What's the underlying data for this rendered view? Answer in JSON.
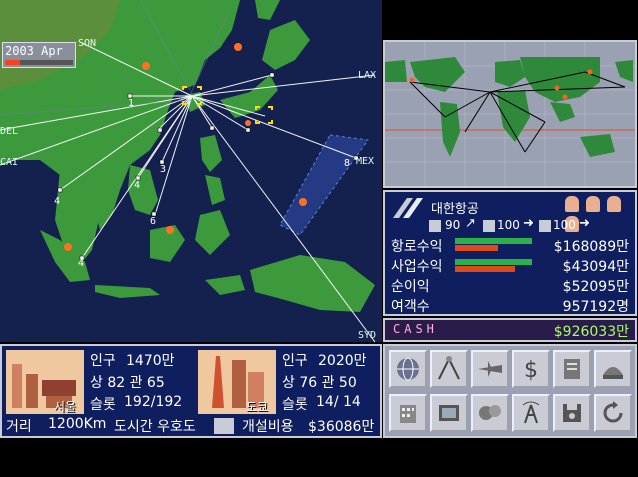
{
  "date": "2003 Apr",
  "map_labels": {
    "seoul_short": "SON",
    "lax": "LAX",
    "mex": "MEX",
    "syd": "SYD",
    "del": "DEL",
    "cai": "CAI",
    "n1": "1",
    "n2": "2",
    "n3": "3",
    "n4a": "4",
    "n4b": "4",
    "n4c": "4",
    "n5": "5",
    "n6": "6",
    "n8": "8"
  },
  "airline": {
    "name": "대한항공",
    "planes_a": "90",
    "planes_b": "100",
    "planes_c": "100",
    "rows": [
      {
        "label": "항로수익",
        "value": "$168089만"
      },
      {
        "label": "사업수익",
        "value": "$43094만"
      },
      {
        "label": "순이익",
        "value": "$52095만"
      },
      {
        "label": "여객수",
        "value": "957192명"
      }
    ],
    "bars": {
      "route_green": 0.9,
      "route_red": 0.5,
      "biz_green": 0.9,
      "biz_red": 0.7
    }
  },
  "cash": {
    "label": "CASH",
    "value": "$926033만"
  },
  "city1": {
    "name": "서울",
    "pop_label": "인구",
    "pop": "1470만",
    "row2": "상 82 관 65",
    "slots_label": "슬롯",
    "slots": "192/192"
  },
  "city2": {
    "name": "도쿄",
    "pop_label": "인구",
    "pop": "2020만",
    "row2": "상 76 관 50",
    "slots_label": "슬롯",
    "slots": "14/ 14"
  },
  "bottom": {
    "distance_label": "거리",
    "distance": "1200Km",
    "time_label": "도시간 우호도",
    "cost_label": "개설비용",
    "cost": "$36086만"
  },
  "commands": [
    "globe-icon",
    "route-icon",
    "plane-icon",
    "dollar-icon",
    "building-icon",
    "hangar-icon",
    "office-icon",
    "tv-icon",
    "talk-icon",
    "antenna-icon",
    "disk-icon",
    "refresh-icon"
  ],
  "colors": {
    "sea": "#14204e",
    "land": "#3c9a3c",
    "panel_blue": "#0e1e5e",
    "panel_grey": "#9aa1b2",
    "cash_green": "#a8ff60",
    "bar_green": "#2bb04a",
    "bar_red": "#e04a1a"
  }
}
